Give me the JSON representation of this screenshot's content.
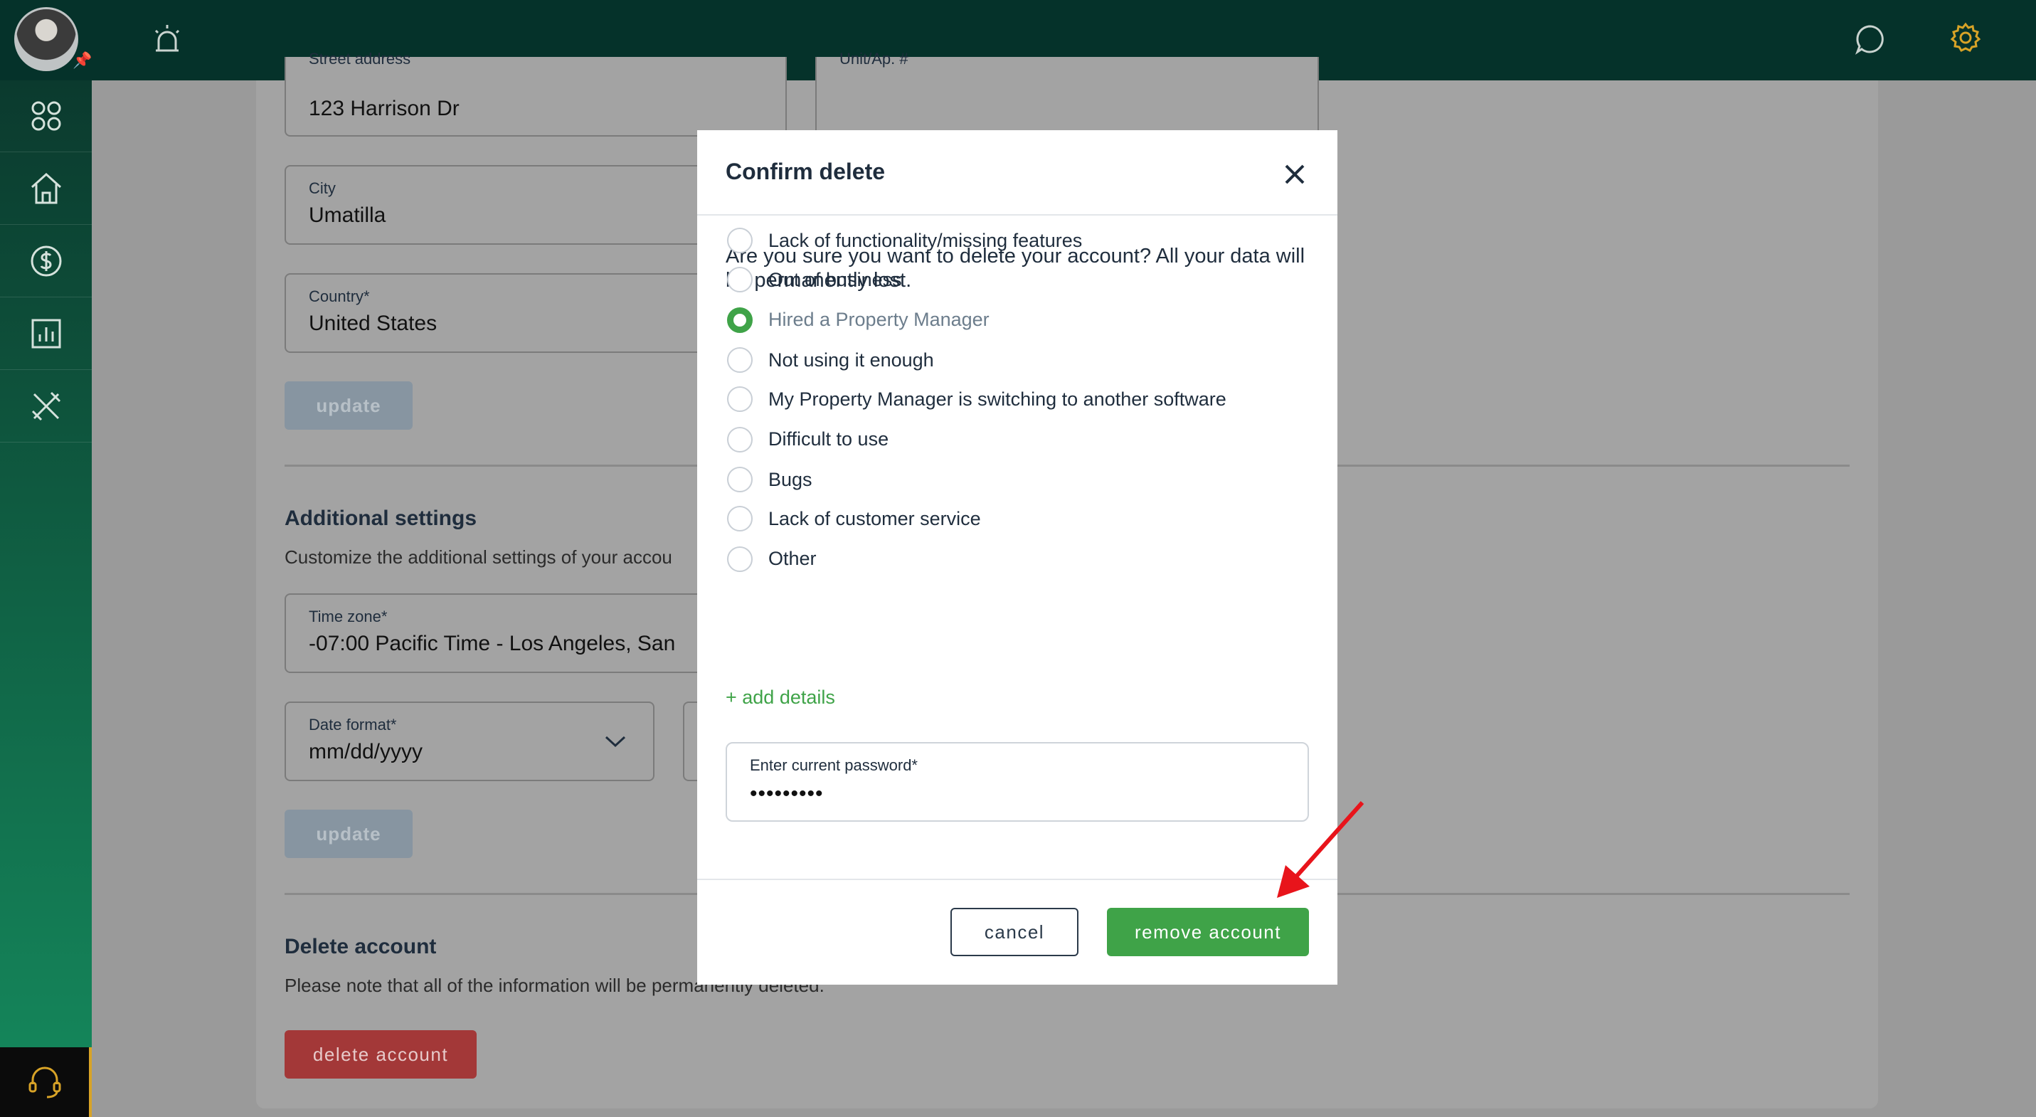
{
  "header": {
    "icons": [
      "avatar",
      "alarm-icon",
      "chat-icon",
      "gear-icon"
    ],
    "accent_color": "#d8a327"
  },
  "sidebar": {
    "items": [
      "apps-icon",
      "home-icon",
      "dollar-icon",
      "chart-icon",
      "tools-icon"
    ],
    "support_icon": "headset-icon"
  },
  "address": {
    "street_label": "Street address",
    "street_value": "123 Harrison Dr",
    "unit_label": "Unit/Ap. #",
    "unit_value": "",
    "city_label": "City",
    "city_value": "Umatilla",
    "country_label": "Country*",
    "country_value": "United States",
    "update_label": "update"
  },
  "additional": {
    "title": "Additional settings",
    "subtitle": "Customize the additional settings of your accou",
    "timezone_label": "Time zone*",
    "timezone_value": "-07:00 Pacific Time - Los Angeles, San",
    "date_format_label": "Date format*",
    "date_format_value": "mm/dd/yyyy",
    "update_label": "update"
  },
  "delete_section": {
    "title": "Delete account",
    "subtitle": "Please note that all of the information will be permanently deleted.",
    "button_label": "delete account"
  },
  "modal": {
    "title": "Confirm delete",
    "question": "Are you sure you want to delete your account? All your data will be permanently lost.",
    "options": [
      {
        "label": "Lack of functionality/missing features",
        "checked": false
      },
      {
        "label": "Out of business",
        "checked": false
      },
      {
        "label": "Hired a Property Manager",
        "checked": true
      },
      {
        "label": "Not using it enough",
        "checked": false
      },
      {
        "label": "My Property Manager is switching to another software",
        "checked": false
      },
      {
        "label": "Difficult to use",
        "checked": false
      },
      {
        "label": "Bugs",
        "checked": false
      },
      {
        "label": "Lack of customer service",
        "checked": false
      },
      {
        "label": "Other",
        "checked": false
      }
    ],
    "add_details": "+ add details",
    "password_label": "Enter current password*",
    "password_value": "•••••••••",
    "cancel_label": "cancel",
    "remove_label": "remove account",
    "primary_color": "#3fa348"
  }
}
